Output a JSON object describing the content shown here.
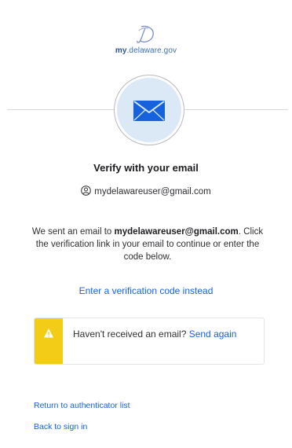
{
  "logo": {
    "brand_my": "my",
    "brand_rest": ".delaware.gov",
    "icon": "delaware-script-d-icon"
  },
  "factor_icon": "envelope-icon",
  "title": "Verify with your email",
  "identifier": {
    "icon": "user-icon",
    "email": "mydelawareuser@gmail.com"
  },
  "message": {
    "prefix": "We sent an email to ",
    "email": "mydelawareuser@gmail.com",
    "suffix": ". Click the verification link in your email to continue or enter the code below."
  },
  "enter_code_link": "Enter a verification code instead",
  "callout": {
    "icon": "warning-icon",
    "text": "Haven't received an email? ",
    "link": "Send again"
  },
  "links": {
    "return": "Return to authenticator list",
    "back": "Back to sign in"
  },
  "colors": {
    "link": "#1662dd",
    "warning": "#f3cc17",
    "icon_bg": "#dbe9f7",
    "envelope": "#1662dd"
  }
}
